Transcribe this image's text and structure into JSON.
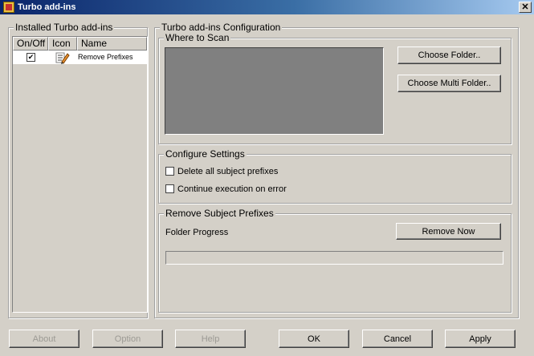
{
  "window": {
    "title": "Turbo add-ins"
  },
  "installed": {
    "title": "Installed Turbo add-ins",
    "columns": [
      "On/Off",
      "Icon",
      "Name"
    ],
    "rows": [
      {
        "checked": true,
        "icon": "pencil-document-icon",
        "name": "Remove Prefixes"
      }
    ]
  },
  "config": {
    "title": "Turbo add-ins Configuration",
    "where_to_scan": {
      "title": "Where to Scan",
      "choose_folder": "Choose Folder..",
      "choose_multi_folder": "Choose Multi Folder.."
    },
    "settings": {
      "title": "Configure Settings",
      "options": [
        {
          "label": "Delete all subject prefixes",
          "checked": false
        },
        {
          "label": "Continue execution on error",
          "checked": false
        }
      ]
    },
    "remove_prefixes": {
      "title": "Remove Subject Prefixes",
      "folder_progress": "Folder Progress",
      "remove_now": "Remove Now",
      "progress_fraction": 0
    }
  },
  "footer": {
    "about": "About",
    "option": "Option",
    "help": "Help",
    "ok": "OK",
    "cancel": "Cancel",
    "apply": "Apply"
  },
  "colors": {
    "face": "#d4d0c8",
    "title_start": "#0a246a",
    "title_end": "#a6caf0",
    "scan_area": "#808080",
    "disabled_text": "#9c9a94"
  }
}
